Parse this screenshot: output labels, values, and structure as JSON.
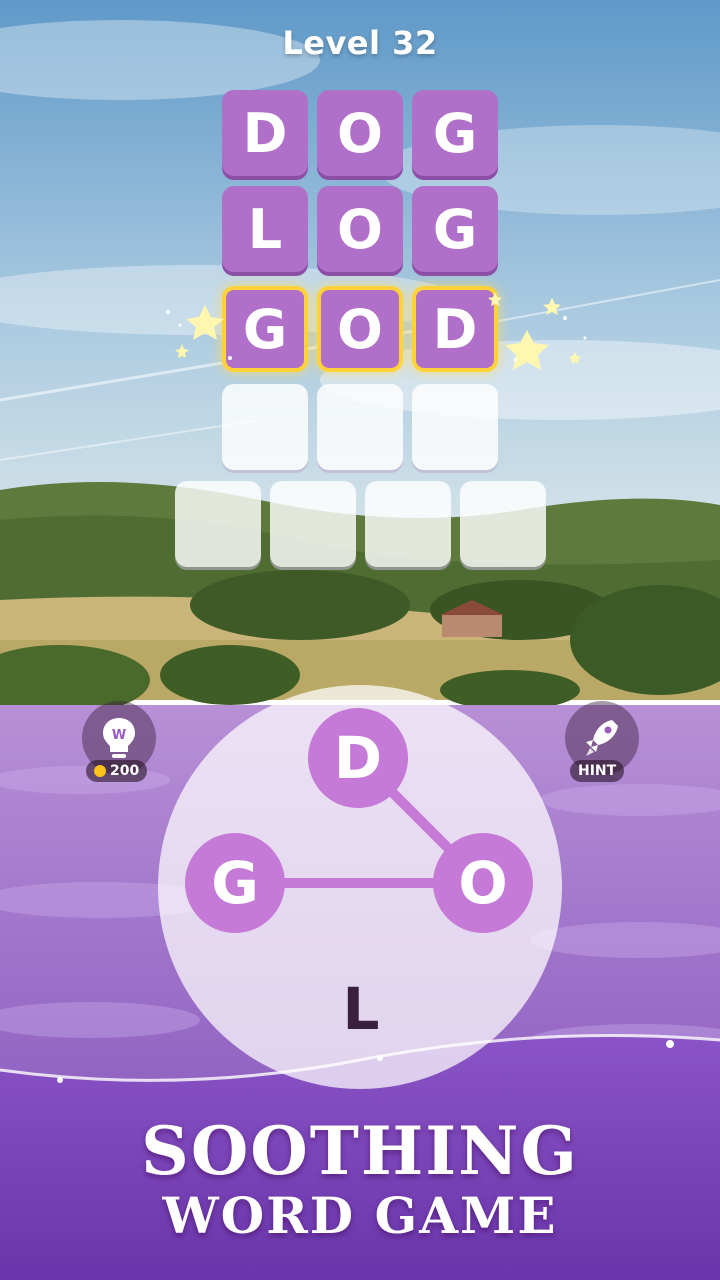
{
  "header": {
    "level_label": "Level 32"
  },
  "grid": {
    "rows": [
      {
        "state": "filled",
        "letters": [
          "D",
          "O",
          "G"
        ]
      },
      {
        "state": "filled",
        "letters": [
          "L",
          "O",
          "G"
        ]
      },
      {
        "state": "highlighted",
        "letters": [
          "G",
          "O",
          "D"
        ]
      },
      {
        "state": "empty",
        "letters": [
          "",
          "",
          ""
        ]
      },
      {
        "state": "empty",
        "letters": [
          "",
          "",
          "",
          ""
        ]
      }
    ]
  },
  "booster": {
    "icon": "lightbulb-icon",
    "coin_icon": "coin-icon",
    "cost": "200"
  },
  "hint": {
    "icon": "rocket-icon",
    "label": "HINT"
  },
  "wheel": {
    "letters": [
      {
        "letter": "D",
        "selected": true
      },
      {
        "letter": "G",
        "selected": true
      },
      {
        "letter": "O",
        "selected": true
      },
      {
        "letter": "L",
        "selected": false
      }
    ]
  },
  "banner": {
    "line1": "SOOTHING",
    "line2": "WORD GAME"
  },
  "colors": {
    "tile": "#b06fc8",
    "highlight": "#ffd23a",
    "wheel_select": "#c47ad6",
    "banner": "#7a3fb8"
  }
}
